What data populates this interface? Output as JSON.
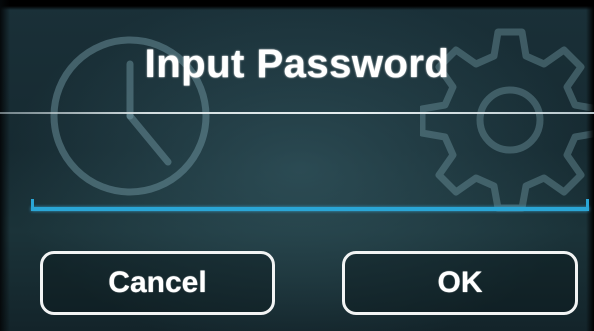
{
  "dialog": {
    "title": "Input Password",
    "password_value": "",
    "cancel_label": "Cancel",
    "ok_label": "OK"
  },
  "background_icons": [
    "clock-icon",
    "gear-icon"
  ],
  "colors": {
    "background": "#162a31",
    "accent_underline": "#2aa6d6",
    "text": "#ffffff",
    "button_border": "#f2f4f4"
  }
}
